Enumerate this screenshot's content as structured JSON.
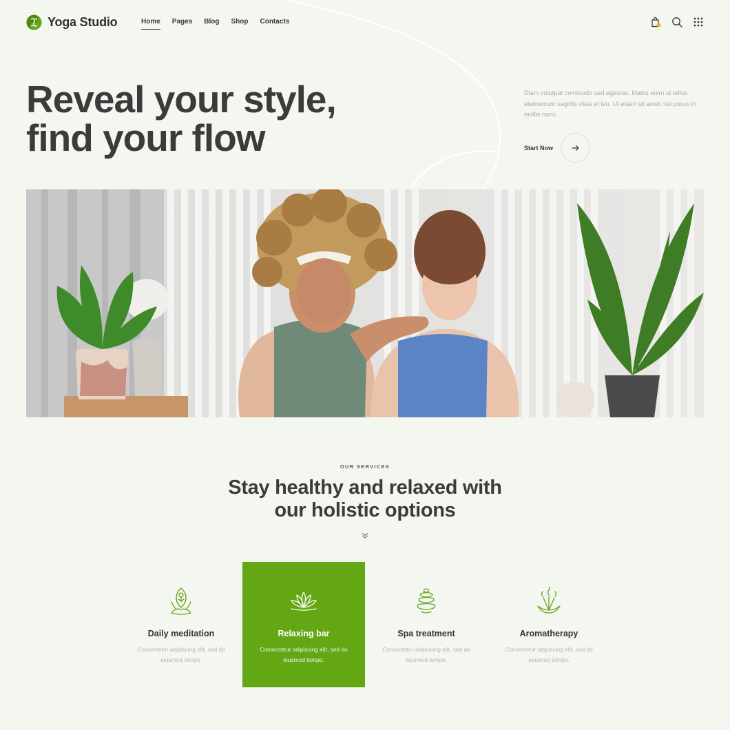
{
  "brand": {
    "name": "Yoga Studio",
    "accent": "#63a715"
  },
  "nav": {
    "items": [
      {
        "label": "Home",
        "active": true
      },
      {
        "label": "Pages",
        "active": false
      },
      {
        "label": "Blog",
        "active": false
      },
      {
        "label": "Shop",
        "active": false
      },
      {
        "label": "Contacts",
        "active": false
      }
    ]
  },
  "header_icons": [
    "shopping-bag-icon",
    "search-icon",
    "grid-menu-icon"
  ],
  "hero": {
    "title_line1": "Reveal your style,",
    "title_line2": "find your flow",
    "description": "Diam volutpat commodo sed egestas. Mattis enim ut tellus elementum sagittis vitae et leo. Ut etiam sit amet nisl purus in mollis nunc.",
    "cta_label": "Start Now"
  },
  "services": {
    "eyebrow": "OUR SERVICES",
    "title_line1": "Stay healthy and relaxed with",
    "title_line2": "our holistic options",
    "items": [
      {
        "title": "Daily meditation",
        "text": "Consectetur adipiscing elit, sed do eiusmod tempo.",
        "icon": "meditation-icon",
        "active": false
      },
      {
        "title": "Relaxing bar",
        "text": "Consectetur adipiscing elit, sed do eiusmod tempo.",
        "icon": "lotus-icon",
        "active": true
      },
      {
        "title": "Spa treatment",
        "text": "Consectetur adipiscing elit, sed do eiusmod tempo.",
        "icon": "spa-stones-icon",
        "active": false
      },
      {
        "title": "Aromatherapy",
        "text": "Consectetur adipiscing elit, sed do eiusmod tempo.",
        "icon": "aroma-sticks-icon",
        "active": false
      }
    ]
  }
}
